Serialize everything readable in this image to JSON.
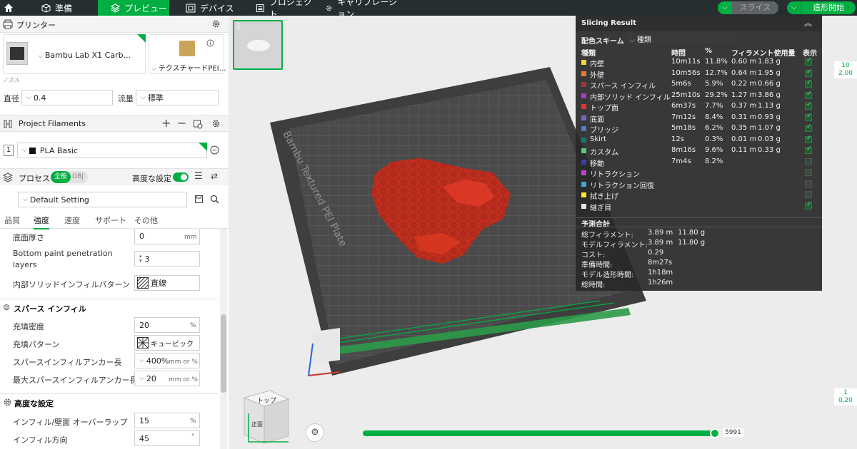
{
  "topbar": {
    "tabs": [
      {
        "label": "準備"
      },
      {
        "label": "プレビュー"
      },
      {
        "label": "デバイス"
      },
      {
        "label": "プロジェクト"
      },
      {
        "label": "キャリブレーション"
      }
    ],
    "slice_label": "スライス",
    "print_label": "造形開始"
  },
  "printer": {
    "title": "プリンター",
    "name": "Bambu Lab X1 Carb...",
    "plate": "テクスチャードPEI...",
    "nozzle_section": "ノズル",
    "diameter_label": "直径",
    "diameter_value": "0.4",
    "flow_label": "流量",
    "flow_value": "標準"
  },
  "filaments": {
    "title": "Project Filaments",
    "slot": "1",
    "name": "PLA Basic"
  },
  "process": {
    "title": "プロセス",
    "toggle_all": "全般",
    "toggle_obj": "OBJ",
    "advanced_label": "高度な設定",
    "preset": "Default Setting",
    "tabs": [
      "品質",
      "強度",
      "速度",
      "サポート",
      "その他"
    ]
  },
  "settings": {
    "bottom_thickness_label": "底面厚さ",
    "bottom_thickness_value": "0",
    "bottom_thickness_unit": "mm",
    "bottom_paint_label_1": "Bottom paint penetration",
    "bottom_paint_label_2": "layers",
    "bottom_paint_value": "3",
    "internal_solid_label": "内部ソリッドインフィルパターン",
    "internal_solid_value": "直線",
    "sparse_title": "スパース インフィル",
    "density_label": "充填密度",
    "density_value": "20",
    "density_unit": "%",
    "pattern_label": "充填パターン",
    "pattern_value": "キュービック",
    "anchor_label": "スパースインフィルアンカー長",
    "anchor_value": "400%",
    "anchor_unit": "mm or %",
    "anchor_max_label": "最大スパースインフィルアンカー長",
    "anchor_max_value": "20",
    "anchor_max_unit": "mm or %",
    "advanced_title": "高度な設定",
    "overlap_label": "インフィル/壁面 オーバーラップ",
    "overlap_value": "15",
    "overlap_unit": "%",
    "direction_label": "インフィル方向",
    "direction_value": "45",
    "direction_unit": "°"
  },
  "viewport": {
    "thumb_index": "1",
    "plate_text": "Bambu Textured PEI Plate",
    "cube_top": "トップ",
    "cube_front": "正面",
    "slider_value": "5991",
    "layer_top": "10",
    "layer_top_height": "2.00",
    "layer_bottom": "1",
    "layer_bottom_height": "0.20"
  },
  "result": {
    "title": "Slicing Result",
    "scheme_label": "配色スキーム",
    "scheme_value": "種類",
    "col_type": "種類",
    "col_time": "時間",
    "col_pct": "%",
    "col_usage": "フィラメント使用量",
    "col_show": "表示",
    "rows": [
      {
        "name": "内壁",
        "color": "#f1d43b",
        "time": "10m11s",
        "pct": "11.8%",
        "len": "0.60 m",
        "wt": "1.83 g",
        "show": true
      },
      {
        "name": "外壁",
        "color": "#ee7a2b",
        "time": "10m56s",
        "pct": "12.7%",
        "len": "0.64 m",
        "wt": "1.95 g",
        "show": true
      },
      {
        "name": "スパース インフィル",
        "color": "#a2333a",
        "time": "5m6s",
        "pct": "5.9%",
        "len": "0.22 m",
        "wt": "0.66 g",
        "show": true
      },
      {
        "name": "内部ソリッド インフィル",
        "color": "#a13ebf",
        "time": "25m10s",
        "pct": "29.2%",
        "len": "1.27 m",
        "wt": "3.86 g",
        "show": true
      },
      {
        "name": "トップ面",
        "color": "#e63131",
        "time": "6m37s",
        "pct": "7.7%",
        "len": "0.37 m",
        "wt": "1.13 g",
        "show": true
      },
      {
        "name": "底面",
        "color": "#7764c9",
        "time": "7m12s",
        "pct": "8.4%",
        "len": "0.31 m",
        "wt": "0.93 g",
        "show": true
      },
      {
        "name": "ブリッジ",
        "color": "#4d7bc7",
        "time": "5m18s",
        "pct": "6.2%",
        "len": "0.35 m",
        "wt": "1.07 g",
        "show": true
      },
      {
        "name": "Skirt",
        "color": "#127a6f",
        "time": "12s",
        "pct": "0.3%",
        "len": "0.01 m",
        "wt": "0.03 g",
        "show": true
      },
      {
        "name": "カスタム",
        "color": "#5ec97a",
        "time": "8m16s",
        "pct": "9.6%",
        "len": "0.11 m",
        "wt": "0.33 g",
        "show": true
      },
      {
        "name": "移動",
        "color": "#3d3da8",
        "time": "7m4s",
        "pct": "8.2%",
        "len": "",
        "wt": "",
        "show": false
      },
      {
        "name": "リトラクション",
        "color": "#c53fcf",
        "time": "",
        "pct": "",
        "len": "",
        "wt": "",
        "show": false
      },
      {
        "name": "リトラクション回復",
        "color": "#3fa7d8",
        "time": "",
        "pct": "",
        "len": "",
        "wt": "",
        "show": false
      },
      {
        "name": "拭き上げ",
        "color": "#f7ea2a",
        "time": "",
        "pct": "",
        "len": "",
        "wt": "",
        "show": false
      },
      {
        "name": "継ぎ目",
        "color": "#e6e6e6",
        "time": "",
        "pct": "",
        "len": "",
        "wt": "",
        "show": true
      }
    ],
    "summary_title": "予測合計",
    "summary": [
      {
        "label": "総フィラメント:",
        "v1": "3.89 m",
        "v2": "11.80 g"
      },
      {
        "label": "モデルフィラメント:",
        "v1": "3.89 m",
        "v2": "11.80 g"
      },
      {
        "label": "コスト:",
        "v1": "0.29",
        "v2": ""
      },
      {
        "label": "準備時間:",
        "v1": "8m27s",
        "v2": ""
      },
      {
        "label": "モデル造形時間:",
        "v1": "1h18m",
        "v2": ""
      },
      {
        "label": "総時間:",
        "v1": "1h26m",
        "v2": ""
      }
    ]
  },
  "colors": {
    "accent": "#00ae42",
    "topbar": "#262e30",
    "toolpath": "#d63a2a"
  }
}
